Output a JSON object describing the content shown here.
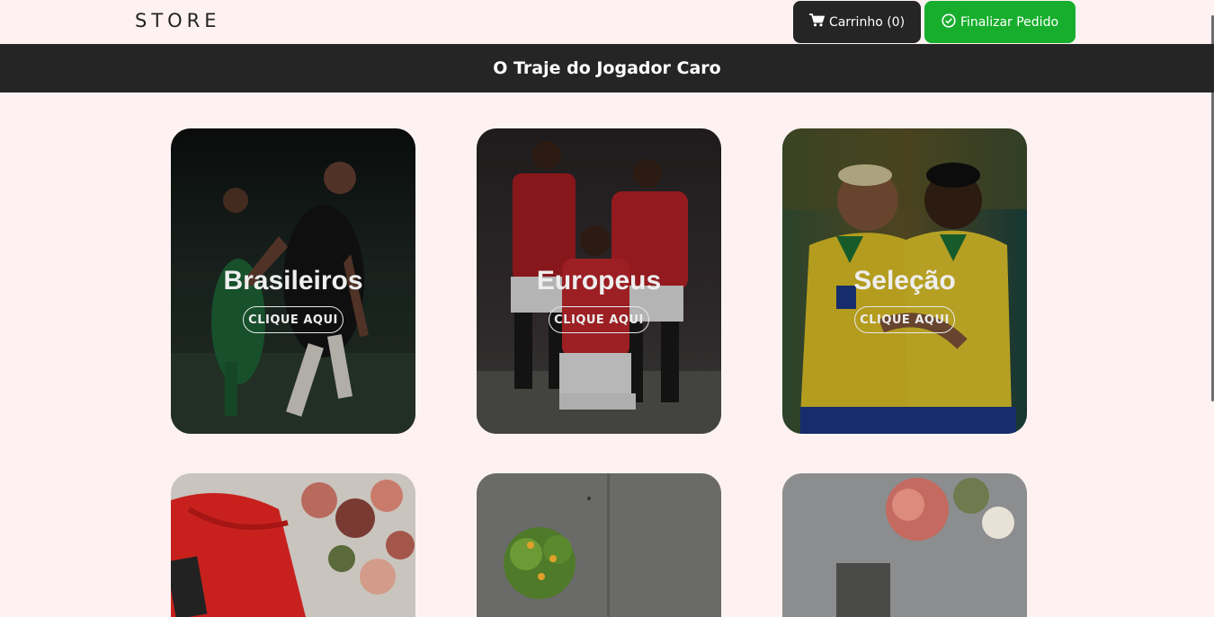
{
  "navbar": {
    "brand": "STORE",
    "cart_label": "Carrinho (0)",
    "cart_icon": "cart-icon",
    "checkout_label": "Finalizar Pedido",
    "checkout_icon": "check-circle-icon"
  },
  "banner": {
    "title": "O Traje do Jogador Caro"
  },
  "categories": [
    {
      "title": "Brasileiros",
      "button": "CLIQUE AQUI"
    },
    {
      "title": "Europeus",
      "button": "CLIQUE AQUI"
    },
    {
      "title": "Seleção",
      "button": "CLIQUE AQUI"
    }
  ],
  "colors": {
    "page_bg": "#fdf2f1",
    "dark": "#252525",
    "checkout_green": "#17ae2d"
  }
}
